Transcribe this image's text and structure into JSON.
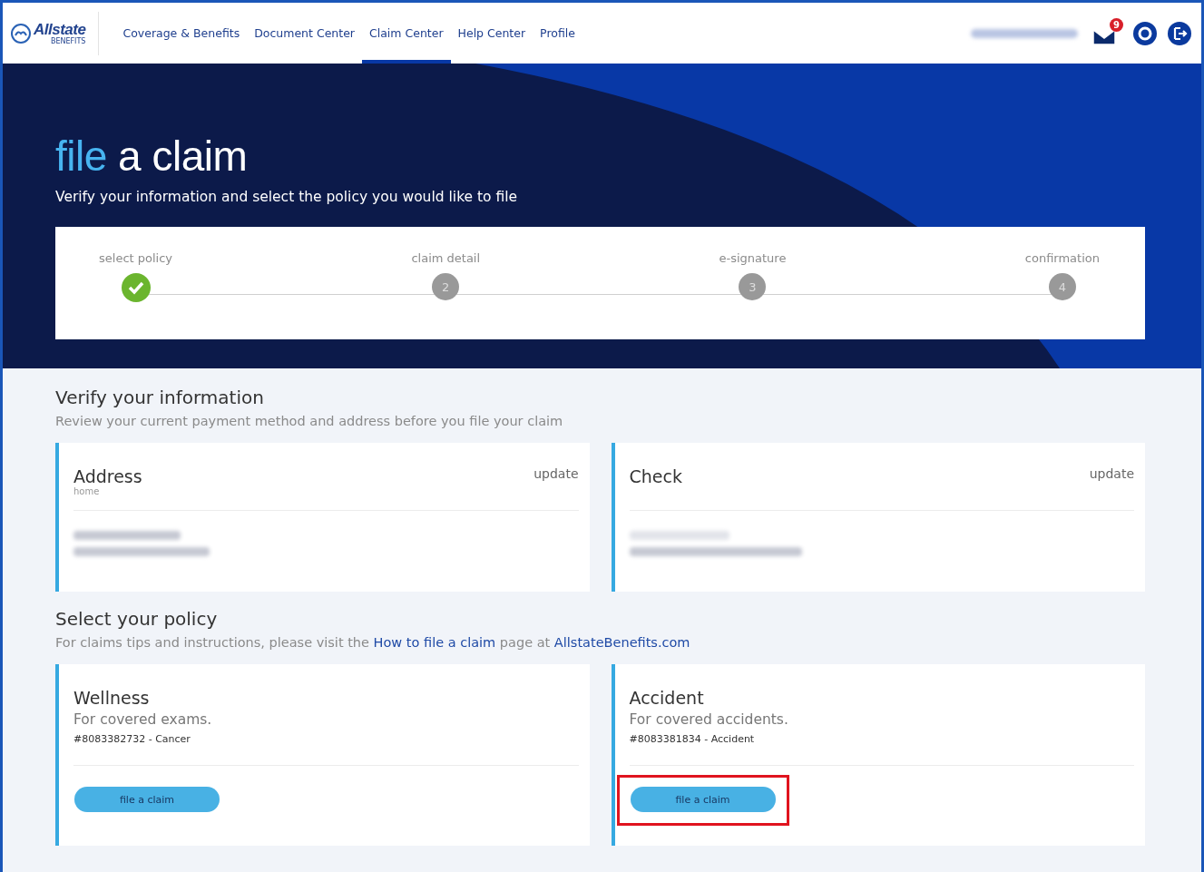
{
  "header": {
    "logo": {
      "name": "Allstate",
      "sub": "BENEFITS"
    },
    "nav": [
      {
        "label": "Coverage & Benefits",
        "selected": false
      },
      {
        "label": "Document Center",
        "selected": false
      },
      {
        "label": "Claim Center",
        "selected": true
      },
      {
        "label": "Help Center",
        "selected": false
      },
      {
        "label": "Profile",
        "selected": false
      }
    ],
    "mail_badge": "9"
  },
  "hero": {
    "title_highlight": "file",
    "title_rest": "a claim",
    "subtitle": "Verify your information and select the policy you would like to file"
  },
  "steps": [
    {
      "label": "select policy",
      "done": true
    },
    {
      "label": "claim detail",
      "number": "2",
      "done": false
    },
    {
      "label": "e-signature",
      "number": "3",
      "done": false
    },
    {
      "label": "confirmation",
      "number": "4",
      "done": false
    }
  ],
  "verify": {
    "title": "Verify your information",
    "subtitle": "Review your current payment method and address before you file your claim",
    "cards": [
      {
        "title": "Address",
        "sub": "home",
        "action": "update"
      },
      {
        "title": "Check",
        "action": "update"
      }
    ]
  },
  "policy": {
    "title": "Select your policy",
    "intro": "For claims tips and instructions, please visit the",
    "link": "How to file a claim",
    "mid": "page at",
    "site": "AllstateBenefits.com",
    "cards": [
      {
        "title": "Wellness",
        "desc": "For covered exams.",
        "number": "#8083382732 - Cancer",
        "button": "file a claim",
        "highlighted": false
      },
      {
        "title": "Accident",
        "desc": "For covered accidents.",
        "number": "#8083381834 - Accident",
        "button": "file a claim",
        "highlighted": true
      }
    ]
  }
}
